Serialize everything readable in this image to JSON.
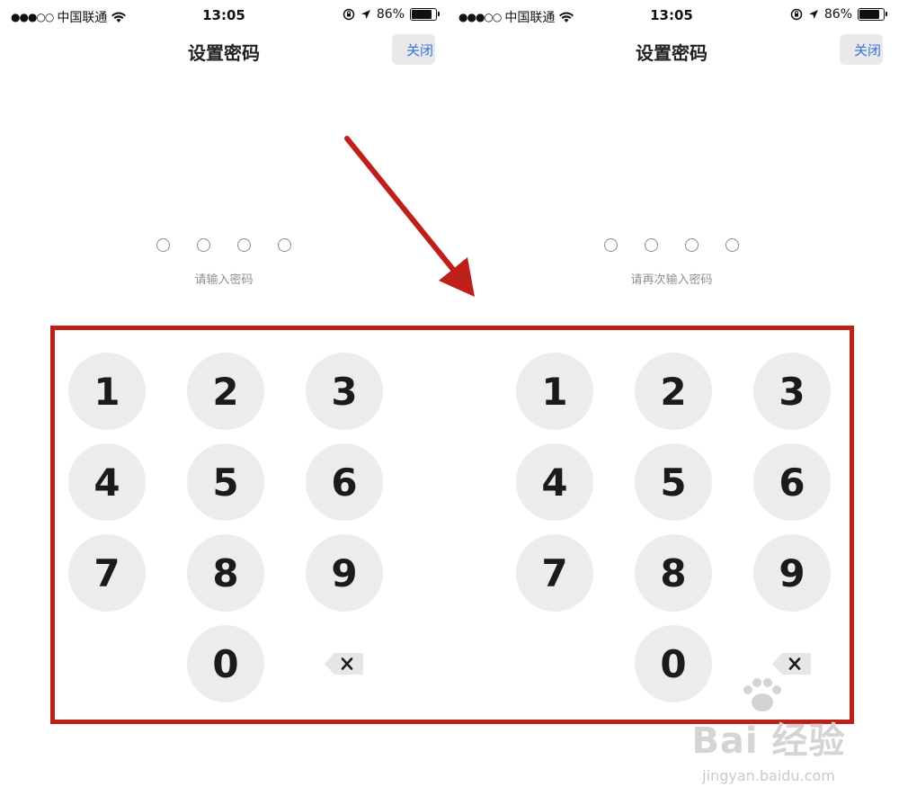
{
  "status_bar": {
    "signal_dots": "●●●○○",
    "carrier": "中国联通",
    "time": "13:05",
    "battery_percent": "86%",
    "battery_level": 0.86
  },
  "screens": [
    {
      "title": "设置密码",
      "close_label": "关闭",
      "prompt": "请输入密码"
    },
    {
      "title": "设置密码",
      "close_label": "关闭",
      "prompt": "请再次输入密码"
    }
  ],
  "keypad": {
    "keys": [
      "1",
      "2",
      "3",
      "4",
      "5",
      "6",
      "7",
      "8",
      "9",
      "0"
    ],
    "delete_icon": "backspace-icon"
  },
  "annotation": {
    "frame_color": "#bf1f1a",
    "arrow_color": "#bf1f1a"
  },
  "watermark": {
    "logo_text": "Bai 经验",
    "url": "jingyan.baidu.com"
  },
  "colors": {
    "accent": "#3a6fd8",
    "key_background": "#ececec"
  }
}
